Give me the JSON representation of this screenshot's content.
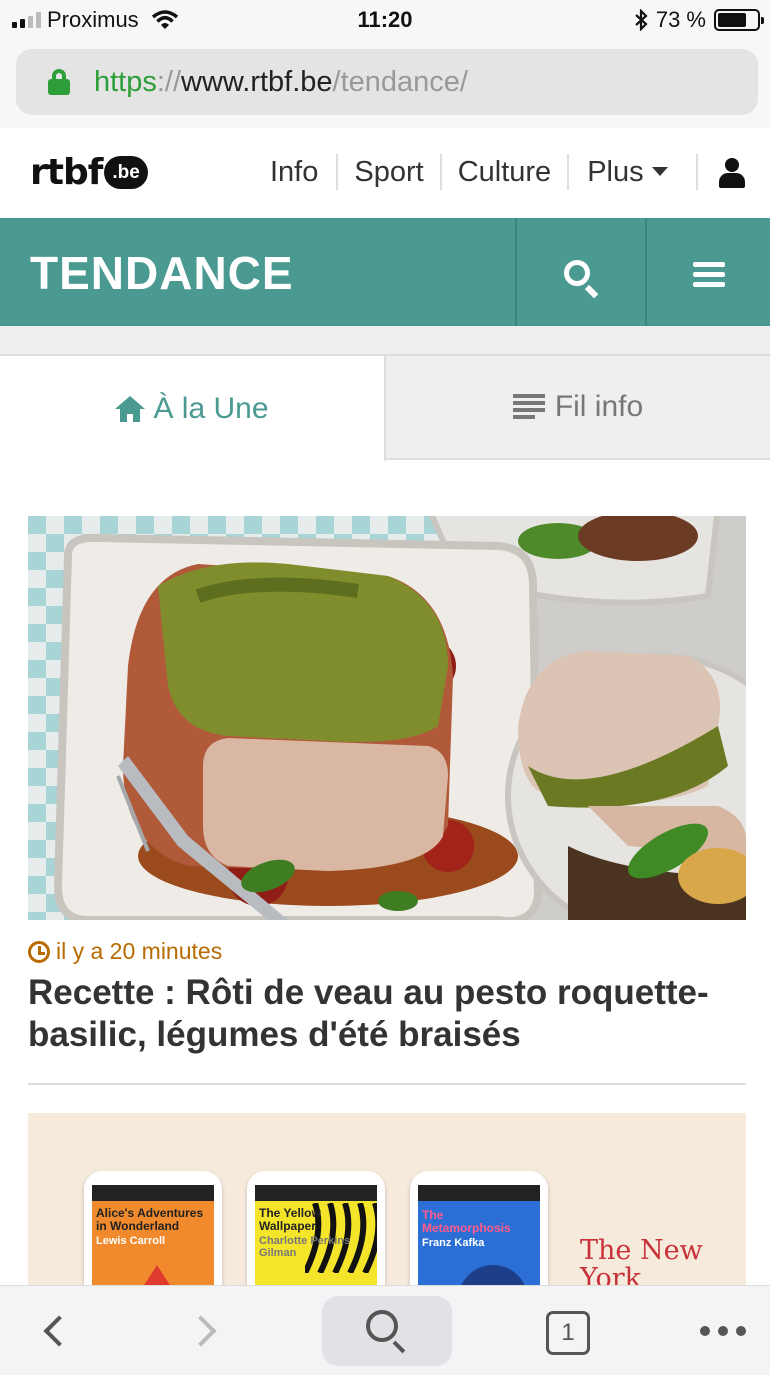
{
  "status_bar": {
    "carrier": "Proximus",
    "time": "11:20",
    "battery": "73 %",
    "battery_level": 0.73
  },
  "url_bar": {
    "scheme": "https",
    "separator": "://",
    "host": "www.rtbf.be",
    "path": "/tendance/"
  },
  "site_header": {
    "logo_text": "rtbf",
    "logo_badge": ".be",
    "nav": [
      "Info",
      "Sport",
      "Culture",
      "Plus"
    ]
  },
  "banner": {
    "title": "TENDANCE"
  },
  "tabs": {
    "active": "À la Une",
    "inactive": "Fil info"
  },
  "articles": [
    {
      "time": "il y a 20 minutes",
      "title": "Recette : Rôti de veau au pesto roquette-basilic, légumes d'été braisés"
    },
    {
      "books": [
        {
          "title": "Alice's Adventures in Wonderland",
          "author": "Lewis Carroll"
        },
        {
          "title": "The Yellow Wallpaper",
          "author": "Charlotte Perkins Gilman"
        },
        {
          "title": "The Metamorphosis",
          "author": "Franz Kafka"
        }
      ],
      "brand": "The New York"
    }
  ],
  "toolbar": {
    "tab_count": "1"
  },
  "colors": {
    "teal": "#4a9a92",
    "secure_green": "#2e9e3a",
    "timestamp": "#b86b00"
  }
}
